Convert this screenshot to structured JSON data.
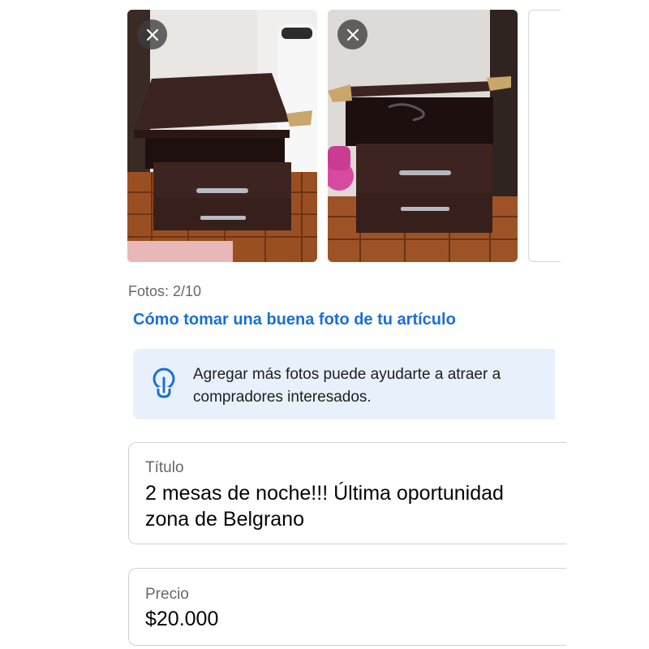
{
  "photos": {
    "items": [
      {
        "name": "nightstand-photo-1",
        "remove_icon": "close-icon"
      },
      {
        "name": "nightstand-photo-2",
        "remove_icon": "close-icon"
      }
    ],
    "count_text": "Fotos: 2/10"
  },
  "help_link": "Cómo tomar una buena foto de tu artículo",
  "tip": {
    "icon": "lightbulb-icon",
    "text": "Agregar más fotos puede ayudarte a atraer a\ncompradores interesados."
  },
  "fields": {
    "title": {
      "label": "Título",
      "value": "2 mesas de noche!!! Última oportunidad\nzona de Belgrano"
    },
    "price": {
      "label": "Precio",
      "value": "$20.000"
    }
  },
  "colors": {
    "link": "#1a6fd6",
    "tip_background": "#e8f1fb",
    "muted_text": "#65676b",
    "border": "#cfd2d6"
  }
}
